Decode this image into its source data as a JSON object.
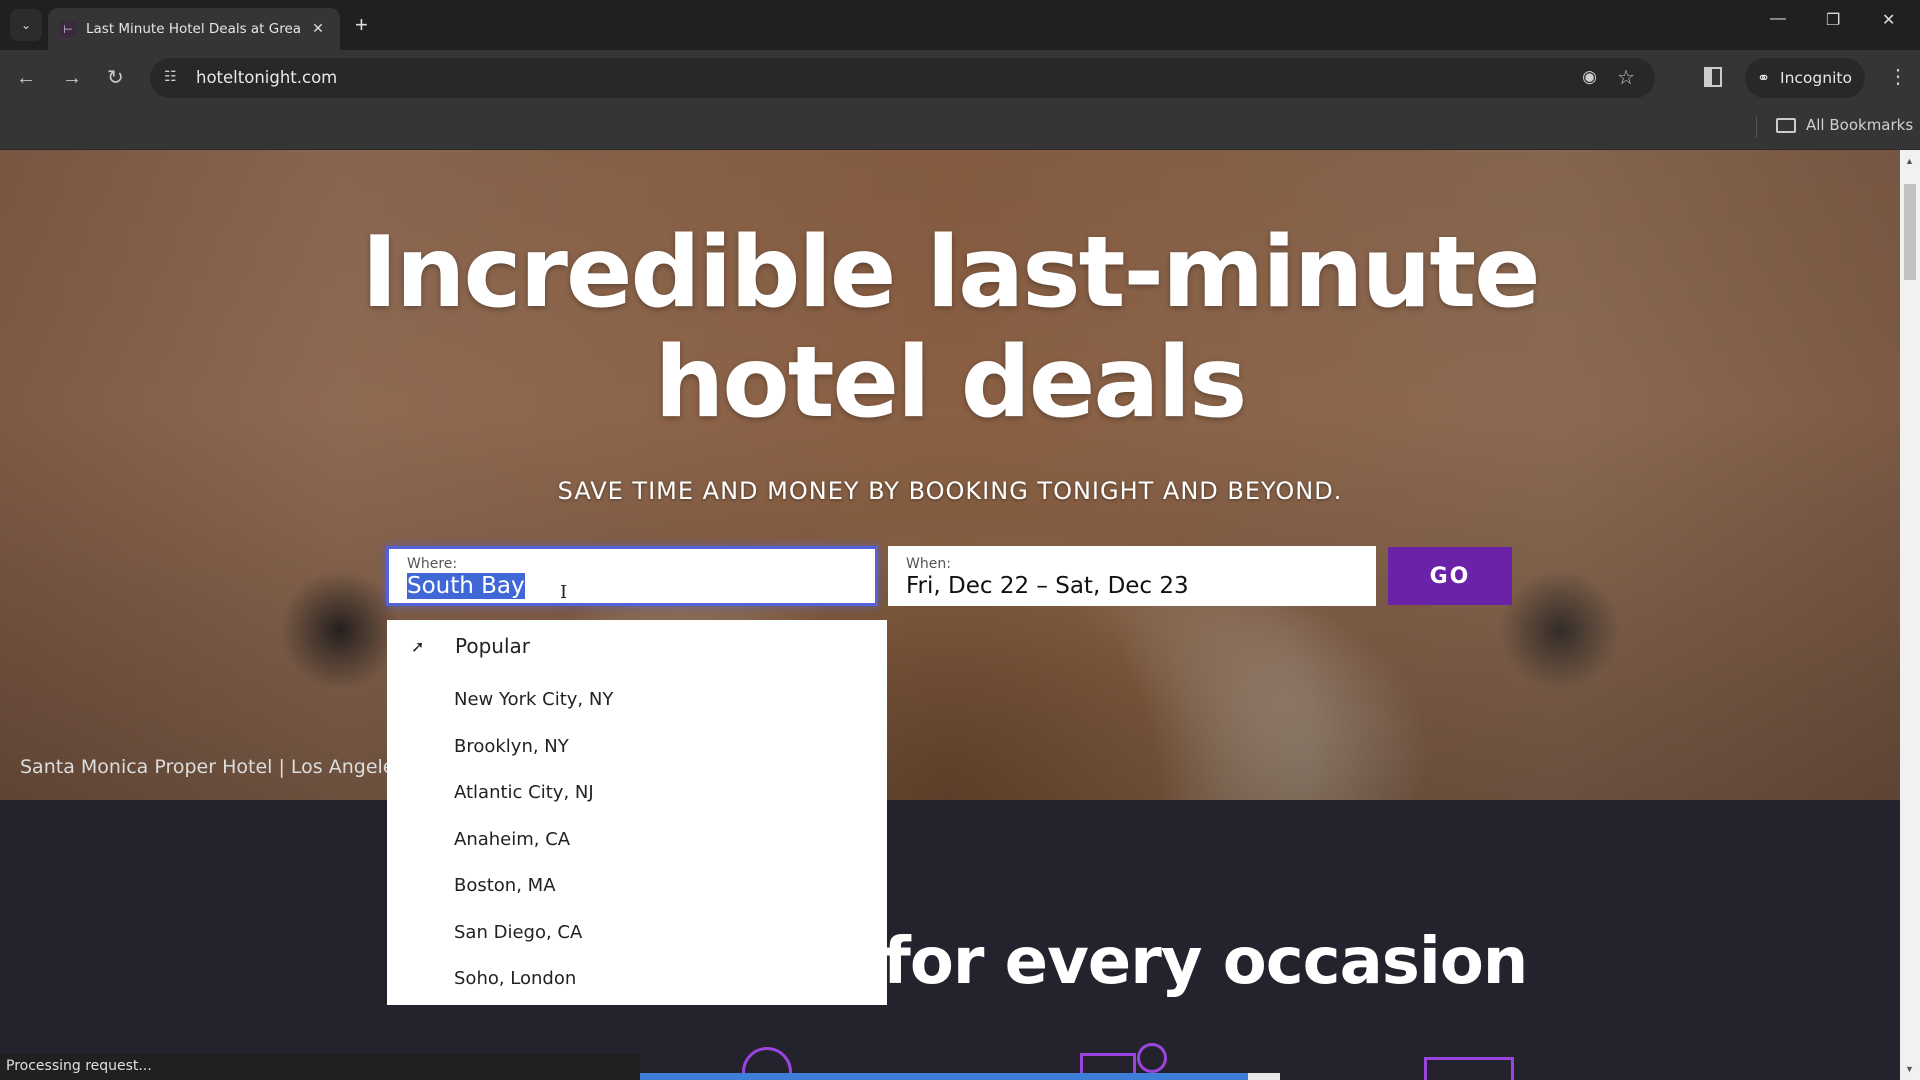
{
  "browser": {
    "tab_title": "Last Minute Hotel Deals at Grea",
    "favicon": "bed-icon",
    "url": "hoteltonight.com",
    "profile_label": "Incognito",
    "bookmarks_label": "All Bookmarks",
    "status_text": "Processing request...",
    "progress_fraction": 0.95
  },
  "hero": {
    "headline_line1": "Incredible last-minute",
    "headline_line2": "hotel deals",
    "subheading": "SAVE TIME AND MONEY BY BOOKING TONIGHT AND BEYOND.",
    "photo_caption": "Santa Monica Proper Hotel | Los Angele"
  },
  "search": {
    "where_label": "Where:",
    "where_value": "South Bay",
    "when_label": "When:",
    "when_value": "Fri, Dec 22 – Sat, Dec 23",
    "go_label": "GO"
  },
  "dropdown": {
    "section_label": "Popular",
    "items": [
      "New York City, NY",
      "Brooklyn, NY",
      "Atlantic City, NJ",
      "Anaheim, CA",
      "Boston, MA",
      "San Diego, CA",
      "Soho, London"
    ]
  },
  "section": {
    "heading_fragment": "for every occasion"
  },
  "colors": {
    "accent_purple": "#6a23a8",
    "icon_purple": "#9b45e0",
    "focus_blue": "#5662d8",
    "selection_blue": "#3f67d6",
    "dark_bg": "#24222c"
  }
}
